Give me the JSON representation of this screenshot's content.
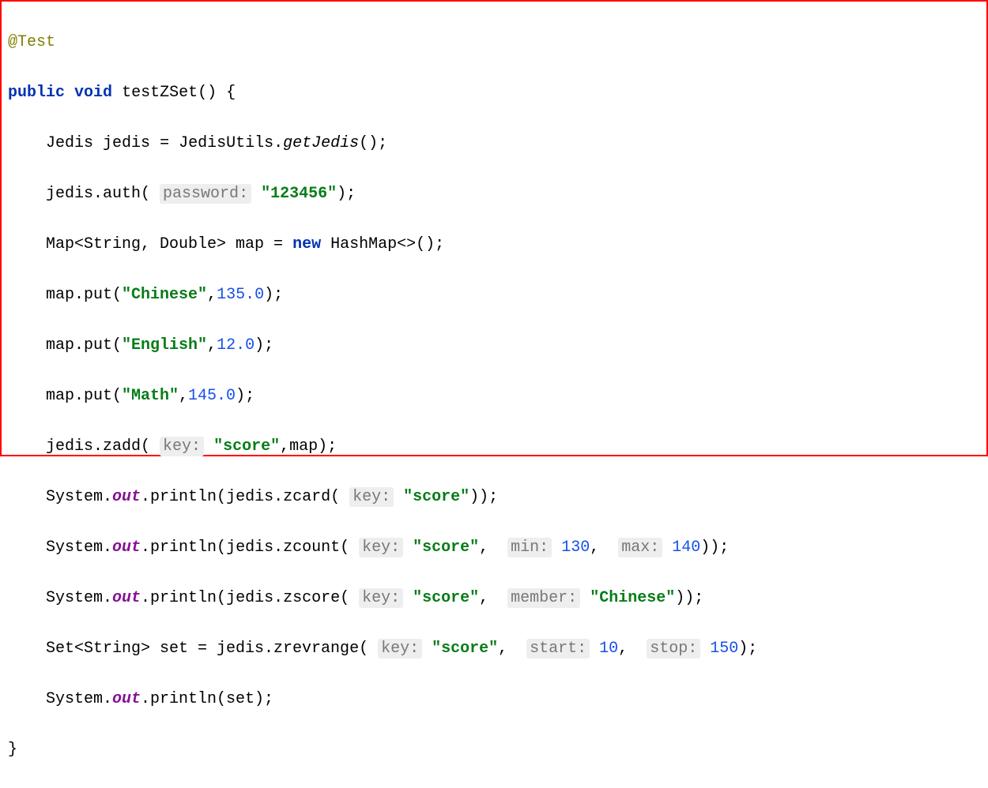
{
  "lines": {
    "annotation": "@Test",
    "public": "public",
    "void": "void",
    "method_name": "testZSet",
    "jedis_type": "Jedis",
    "jedis_var": "jedis",
    "jedis_utils": "JedisUtils",
    "get_jedis": "getJedis",
    "auth": "auth",
    "password_hint": "password:",
    "password_val": "\"123456\"",
    "map_decl": "Map<String, Double> map = ",
    "new_kw": "new",
    "hashmap": " HashMap<>();",
    "map_put1_call": "map.put(",
    "chinese": "\"Chinese\"",
    "val_135": "135.0",
    "english": "\"English\"",
    "val_12": "12.0",
    "math": "\"Math\"",
    "val_145": "145.0",
    "zadd_call": "jedis.zadd( ",
    "key_hint": "key:",
    "score": "\"score\"",
    "zadd_end": ",map);",
    "system": "System.",
    "out": "out",
    "println": ".println(",
    "zcard": "jedis.zcard( ",
    "zcount": "jedis.zcount( ",
    "min_hint": "min:",
    "val_130": "130",
    "max_hint": "max:",
    "val_140": "140",
    "zscore": "jedis.zscore( ",
    "member_hint": "member:",
    "set_decl": "Set<String> set = jedis.zrevrange( ",
    "start_hint": "start:",
    "val_10": "10",
    "stop_hint": "stop:",
    "val_150": "150",
    "println_set": ".println(set);",
    "close_brace": "}"
  }
}
